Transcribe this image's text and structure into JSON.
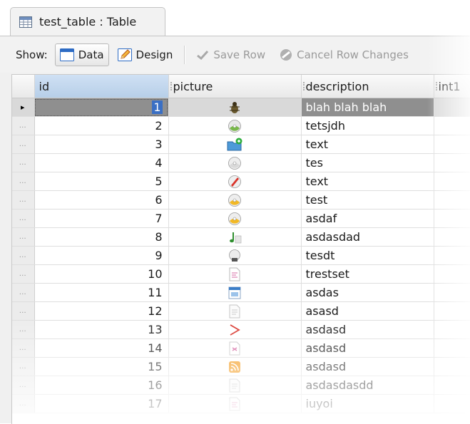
{
  "tab": {
    "title": "test_table : Table",
    "icon": "table-icon"
  },
  "toolbar": {
    "show_label": "Show:",
    "data_label": "Data",
    "design_label": "Design",
    "save_row_label": "Save Row",
    "cancel_label": "Cancel Row Changes"
  },
  "grid": {
    "columns": [
      "id",
      "picture",
      "description",
      "int1"
    ],
    "rows": [
      {
        "id": "1",
        "picture": "bug-icon",
        "description": "blah blah blah"
      },
      {
        "id": "2",
        "picture": "cd-globe-icon",
        "description": "tetsjdh"
      },
      {
        "id": "3",
        "picture": "folder-add-icon",
        "description": "text"
      },
      {
        "id": "4",
        "picture": "cd-icon",
        "description": "tes"
      },
      {
        "id": "5",
        "picture": "cd-red-icon",
        "description": "text"
      },
      {
        "id": "6",
        "picture": "cd-yellow-icon",
        "description": "test"
      },
      {
        "id": "7",
        "picture": "cd-yellow-icon",
        "description": "asdaf"
      },
      {
        "id": "8",
        "picture": "music-note-icon",
        "description": "asdasdad"
      },
      {
        "id": "9",
        "picture": "cd-drive-icon",
        "description": "tesdt"
      },
      {
        "id": "10",
        "picture": "text-doc-icon",
        "description": "trestset"
      },
      {
        "id": "11",
        "picture": "window-app-icon",
        "description": "asdas"
      },
      {
        "id": "12",
        "picture": "document-icon",
        "description": "asasd"
      },
      {
        "id": "13",
        "picture": "pdf-icon",
        "description": "asdasd"
      },
      {
        "id": "14",
        "picture": "image-doc-icon",
        "description": "asdasd"
      },
      {
        "id": "15",
        "picture": "rss-icon",
        "description": "asdasd"
      },
      {
        "id": "16",
        "picture": "document-icon",
        "description": "asdasdasdd"
      },
      {
        "id": "17",
        "picture": "text-doc-icon",
        "description": "iuyoi"
      }
    ],
    "current_row_marker": "▸",
    "row_marker": "…"
  },
  "colors": {
    "selection_blue": "#3a6fc4",
    "header_selected": "#b7cfe8",
    "current_row": "#8f8f8f"
  }
}
